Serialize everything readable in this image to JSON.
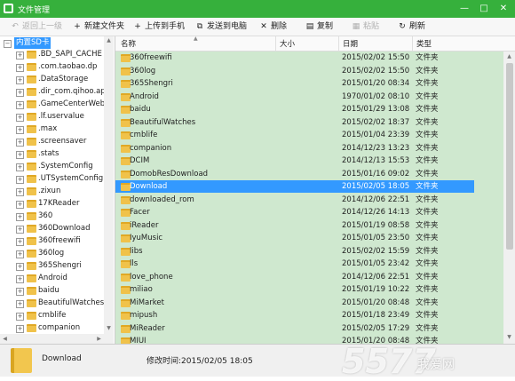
{
  "window": {
    "title": "文件管理"
  },
  "toolbar": {
    "back": "返回上一级",
    "new_folder": "新建文件夹",
    "upload": "上传到手机",
    "send_pc": "发送到电脑",
    "delete": "删除",
    "copy": "复制",
    "paste": "粘贴",
    "refresh": "刷新"
  },
  "tree": {
    "root": "内置SD卡",
    "items": [
      ".BD_SAPI_CACHE",
      ".com.taobao.dp",
      ".DataStorage",
      ".dir_com.qihoo.ap",
      ".GameCenterWebI",
      ".lf.uservalue",
      ".max",
      ".screensaver",
      ".stats",
      ".SystemConfig",
      ".UTSystemConfig",
      ".zixun",
      "17KReader",
      "360",
      "360Download",
      "360freewifi",
      "360log",
      "365Shengri",
      "Android",
      "baidu",
      "BeautifulWatches",
      "cmblife",
      "companion"
    ]
  },
  "columns": {
    "name": "名称",
    "size": "大小",
    "date": "日期",
    "type": "类型"
  },
  "files": [
    {
      "name": "360freewifi",
      "date": "2015/02/02 15:50",
      "type": "文件夹"
    },
    {
      "name": "360log",
      "date": "2015/02/02 15:50",
      "type": "文件夹"
    },
    {
      "name": "365Shengri",
      "date": "2015/01/20 08:34",
      "type": "文件夹"
    },
    {
      "name": "Android",
      "date": "1970/01/02 08:10",
      "type": "文件夹"
    },
    {
      "name": "baidu",
      "date": "2015/01/29 13:08",
      "type": "文件夹"
    },
    {
      "name": "BeautifulWatches",
      "date": "2015/02/02 18:37",
      "type": "文件夹"
    },
    {
      "name": "cmblife",
      "date": "2015/01/04 23:39",
      "type": "文件夹"
    },
    {
      "name": "companion",
      "date": "2014/12/23 13:23",
      "type": "文件夹"
    },
    {
      "name": "DCIM",
      "date": "2014/12/13 15:53",
      "type": "文件夹"
    },
    {
      "name": "DomobResDownload",
      "date": "2015/01/16 09:02",
      "type": "文件夹"
    },
    {
      "name": "Download",
      "date": "2015/02/05 18:05",
      "type": "文件夹",
      "selected": true
    },
    {
      "name": "downloaded_rom",
      "date": "2014/12/06 22:51",
      "type": "文件夹"
    },
    {
      "name": "Facer",
      "date": "2014/12/26 14:13",
      "type": "文件夹"
    },
    {
      "name": "iReader",
      "date": "2015/01/19 08:58",
      "type": "文件夹"
    },
    {
      "name": "IyuMusic",
      "date": "2015/01/05 23:50",
      "type": "文件夹"
    },
    {
      "name": "libs",
      "date": "2015/02/02 15:59",
      "type": "文件夹"
    },
    {
      "name": "lls",
      "date": "2015/01/05 23:42",
      "type": "文件夹"
    },
    {
      "name": "love_phone",
      "date": "2014/12/06 22:51",
      "type": "文件夹"
    },
    {
      "name": "miliao",
      "date": "2015/01/19 10:22",
      "type": "文件夹"
    },
    {
      "name": "MiMarket",
      "date": "2015/01/20 08:48",
      "type": "文件夹"
    },
    {
      "name": "mipush",
      "date": "2015/01/18 23:49",
      "type": "文件夹"
    },
    {
      "name": "MiReader",
      "date": "2015/02/05 17:29",
      "type": "文件夹"
    },
    {
      "name": "MIUI",
      "date": "2015/01/20 08:48",
      "type": "文件夹"
    }
  ],
  "status": {
    "name": "Download",
    "modified": "修改时间:2015/02/05 18:05"
  },
  "watermark": {
    "main": "5577",
    "sub": "我爱网"
  }
}
